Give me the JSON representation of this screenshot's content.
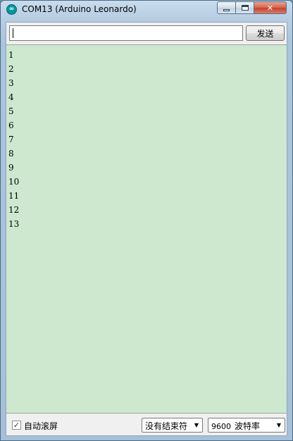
{
  "window": {
    "title": "COM13 (Arduino Leonardo)",
    "icon": "arduino-logo-icon",
    "icon_glyph": "∞",
    "controls": {
      "minimize": "minimize-icon",
      "maximize": "maximize-icon",
      "close": "✕"
    }
  },
  "send_bar": {
    "input_value": "",
    "send_label": "发送"
  },
  "serial_output": {
    "lines": [
      "1",
      "2",
      "3",
      "4",
      "5",
      "6",
      "7",
      "8",
      "9",
      "10",
      "11",
      "12",
      "13"
    ],
    "background": "#cde8cf"
  },
  "footer": {
    "autoscroll_checked": "✓",
    "autoscroll_label": "自动滚屏",
    "line_ending": "没有结束符",
    "baud_value": "9600",
    "baud_label": "波特率",
    "dropdown_arrow": "▼"
  }
}
